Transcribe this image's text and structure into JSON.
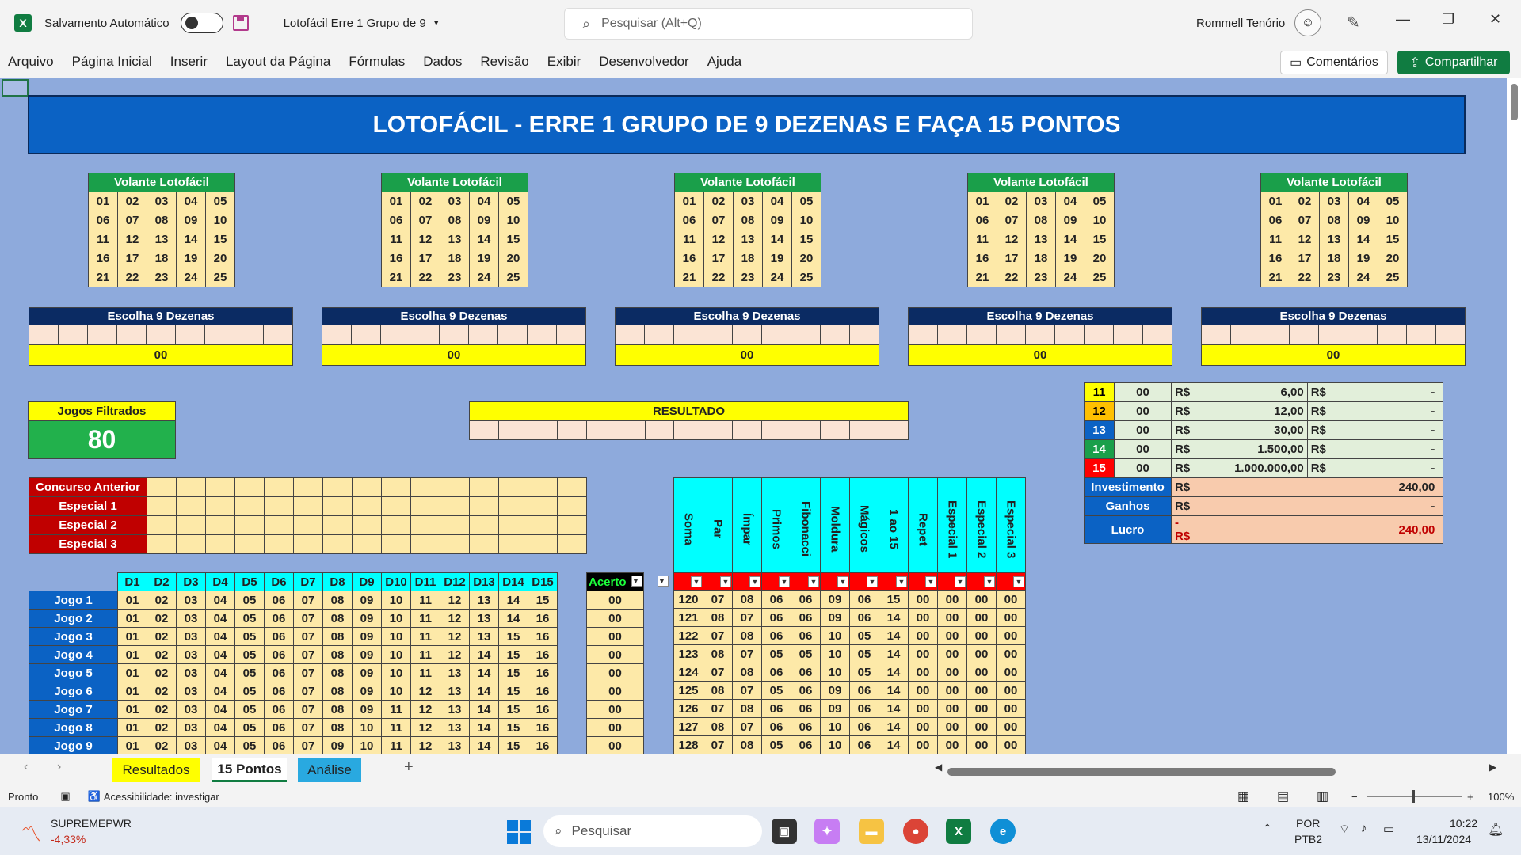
{
  "titlebar": {
    "autosave_label": "Salvamento Automático",
    "doc_title": "Lotofácil Erre 1 Grupo de 9",
    "search_placeholder": "Pesquisar (Alt+Q)",
    "user_name": "Rommell Tenório"
  },
  "ribbon": {
    "menus": [
      "Arquivo",
      "Página Inicial",
      "Inserir",
      "Layout da Página",
      "Fórmulas",
      "Dados",
      "Revisão",
      "Exibir",
      "Desenvolvedor",
      "Ajuda"
    ],
    "comments_label": "Comentários",
    "share_label": "Compartilhar"
  },
  "sheet": {
    "banner": "LOTOFÁCIL - ERRE 1 GRUPO DE 9 DEZENAS E FAÇA 15 PONTOS",
    "volante_title": "Volante Lotofácil",
    "volante_numbers": [
      [
        "01",
        "02",
        "03",
        "04",
        "05"
      ],
      [
        "06",
        "07",
        "08",
        "09",
        "10"
      ],
      [
        "11",
        "12",
        "13",
        "14",
        "15"
      ],
      [
        "16",
        "17",
        "18",
        "19",
        "20"
      ],
      [
        "21",
        "22",
        "23",
        "24",
        "25"
      ]
    ],
    "escolha_title": "Escolha 9 Dezenas",
    "escolha_total": "00",
    "jogos_filtrados_label": "Jogos Filtrados",
    "jogos_filtrados_value": "80",
    "resultado_label": "RESULTADO",
    "especiais": [
      "Concurso Anterior",
      "Especial 1",
      "Especial 2",
      "Especial 3"
    ],
    "prizes": [
      {
        "hits": "11",
        "count": "00",
        "currency": "R$",
        "value": "6,00",
        "currency2": "R$",
        "total": "-",
        "color": "#ffff00"
      },
      {
        "hits": "12",
        "count": "00",
        "currency": "R$",
        "value": "12,00",
        "currency2": "R$",
        "total": "-",
        "color": "#ffc000"
      },
      {
        "hits": "13",
        "count": "00",
        "currency": "R$",
        "value": "30,00",
        "currency2": "R$",
        "total": "-",
        "color": "#0b62c4"
      },
      {
        "hits": "14",
        "count": "00",
        "currency": "R$",
        "value": "1.500,00",
        "currency2": "R$",
        "total": "-",
        "color": "#1a9f4a"
      },
      {
        "hits": "15",
        "count": "00",
        "currency": "R$",
        "value": "1.000.000,00",
        "currency2": "R$",
        "total": "-",
        "color": "#ff0000"
      }
    ],
    "summary": [
      {
        "label": "Investimento",
        "currency": "R$",
        "value": "240,00"
      },
      {
        "label": "Ganhos",
        "currency": "R$",
        "value": "-"
      },
      {
        "label": "Lucro",
        "currency": "-R$",
        "value": "240,00"
      }
    ],
    "stat_headers": [
      "Soma",
      "Par",
      "Ímpar",
      "Primos",
      "Fibonacci",
      "Moldura",
      "Mágicos",
      "1 ao 15",
      "Repet",
      "Especial 1",
      "Especial 2",
      "Especial 3"
    ],
    "jogos_headers": [
      "D1",
      "D2",
      "D3",
      "D4",
      "D5",
      "D6",
      "D7",
      "D8",
      "D9",
      "D10",
      "D11",
      "D12",
      "D13",
      "D14",
      "D15"
    ],
    "acerto_header": "Acerto",
    "jogos": [
      {
        "label": "Jogo 1",
        "nums": [
          "01",
          "02",
          "03",
          "04",
          "05",
          "06",
          "07",
          "08",
          "09",
          "10",
          "11",
          "12",
          "13",
          "14",
          "15"
        ],
        "acerto": "00",
        "stats": [
          "120",
          "07",
          "08",
          "06",
          "06",
          "09",
          "06",
          "15",
          "00",
          "00",
          "00",
          "00"
        ]
      },
      {
        "label": "Jogo 2",
        "nums": [
          "01",
          "02",
          "03",
          "04",
          "05",
          "06",
          "07",
          "08",
          "09",
          "10",
          "11",
          "12",
          "13",
          "14",
          "16"
        ],
        "acerto": "00",
        "stats": [
          "121",
          "08",
          "07",
          "06",
          "06",
          "09",
          "06",
          "14",
          "00",
          "00",
          "00",
          "00"
        ]
      },
      {
        "label": "Jogo 3",
        "nums": [
          "01",
          "02",
          "03",
          "04",
          "05",
          "06",
          "07",
          "08",
          "09",
          "10",
          "11",
          "12",
          "13",
          "15",
          "16"
        ],
        "acerto": "00",
        "stats": [
          "122",
          "07",
          "08",
          "06",
          "06",
          "10",
          "05",
          "14",
          "00",
          "00",
          "00",
          "00"
        ]
      },
      {
        "label": "Jogo 4",
        "nums": [
          "01",
          "02",
          "03",
          "04",
          "05",
          "06",
          "07",
          "08",
          "09",
          "10",
          "11",
          "12",
          "14",
          "15",
          "16"
        ],
        "acerto": "00",
        "stats": [
          "123",
          "08",
          "07",
          "05",
          "05",
          "10",
          "05",
          "14",
          "00",
          "00",
          "00",
          "00"
        ]
      },
      {
        "label": "Jogo 5",
        "nums": [
          "01",
          "02",
          "03",
          "04",
          "05",
          "06",
          "07",
          "08",
          "09",
          "10",
          "11",
          "13",
          "14",
          "15",
          "16"
        ],
        "acerto": "00",
        "stats": [
          "124",
          "07",
          "08",
          "06",
          "06",
          "10",
          "05",
          "14",
          "00",
          "00",
          "00",
          "00"
        ]
      },
      {
        "label": "Jogo 6",
        "nums": [
          "01",
          "02",
          "03",
          "04",
          "05",
          "06",
          "07",
          "08",
          "09",
          "10",
          "12",
          "13",
          "14",
          "15",
          "16"
        ],
        "acerto": "00",
        "stats": [
          "125",
          "08",
          "07",
          "05",
          "06",
          "09",
          "06",
          "14",
          "00",
          "00",
          "00",
          "00"
        ]
      },
      {
        "label": "Jogo 7",
        "nums": [
          "01",
          "02",
          "03",
          "04",
          "05",
          "06",
          "07",
          "08",
          "09",
          "11",
          "12",
          "13",
          "14",
          "15",
          "16"
        ],
        "acerto": "00",
        "stats": [
          "126",
          "07",
          "08",
          "06",
          "06",
          "09",
          "06",
          "14",
          "00",
          "00",
          "00",
          "00"
        ]
      },
      {
        "label": "Jogo 8",
        "nums": [
          "01",
          "02",
          "03",
          "04",
          "05",
          "06",
          "07",
          "08",
          "10",
          "11",
          "12",
          "13",
          "14",
          "15",
          "16"
        ],
        "acerto": "00",
        "stats": [
          "127",
          "08",
          "07",
          "06",
          "06",
          "10",
          "06",
          "14",
          "00",
          "00",
          "00",
          "00"
        ]
      },
      {
        "label": "Jogo 9",
        "nums": [
          "01",
          "02",
          "03",
          "04",
          "05",
          "06",
          "07",
          "09",
          "10",
          "11",
          "12",
          "13",
          "14",
          "15",
          "16"
        ],
        "acerto": "00",
        "stats": [
          "128",
          "07",
          "08",
          "05",
          "06",
          "10",
          "06",
          "14",
          "00",
          "00",
          "00",
          "00"
        ]
      }
    ]
  },
  "tabs": [
    {
      "label": "Resultados",
      "bg": "#ffff00"
    },
    {
      "label": "15 Pontos",
      "bg": "#ffffff"
    },
    {
      "label": "Análise",
      "bg": "#29a9e0"
    }
  ],
  "statusbar": {
    "ready": "Pronto",
    "accessibility": "Acessibilidade: investigar",
    "zoom": "100%"
  },
  "taskbar": {
    "stock_name": "SUPREMEPWR",
    "stock_change": "-4,33%",
    "search_placeholder": "Pesquisar",
    "lang1": "POR",
    "lang2": "PTB2",
    "time": "10:22",
    "date": "13/11/2024"
  }
}
